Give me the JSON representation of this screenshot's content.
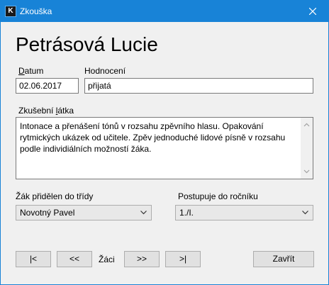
{
  "window": {
    "app_icon_letter": "K",
    "title": "Zkouška"
  },
  "student_name": "Petrásová Lucie",
  "form": {
    "date_label": "Datum",
    "date_value": "02.06.2017",
    "grade_label": "Hodnocení",
    "grade_value": "přijatá",
    "material_label": "Zkušební látka",
    "material_lines": [
      "Intonace a přenášení tónů v rozsahu zpěvního hlasu. Opakování",
      "rytmických ukázek od učitele. Zpěv jednoduché lidové písně v rozsahu",
      "podle individiálních možností žáka."
    ],
    "class_label": "Žák přidělen do třídy",
    "class_value": "Novotný Pavel",
    "year_label": "Postupuje do ročníku",
    "year_value": "1./I."
  },
  "navigation": {
    "first": "|<",
    "prev": "<<",
    "label": "Žáci",
    "next": ">>",
    "last": ">|"
  },
  "close_button": "Zavřít",
  "colors": {
    "titlebar": "#1883d7",
    "background": "#f0f0f0",
    "field_border": "#7a7a7a",
    "button_face": "#e1e1e1"
  }
}
